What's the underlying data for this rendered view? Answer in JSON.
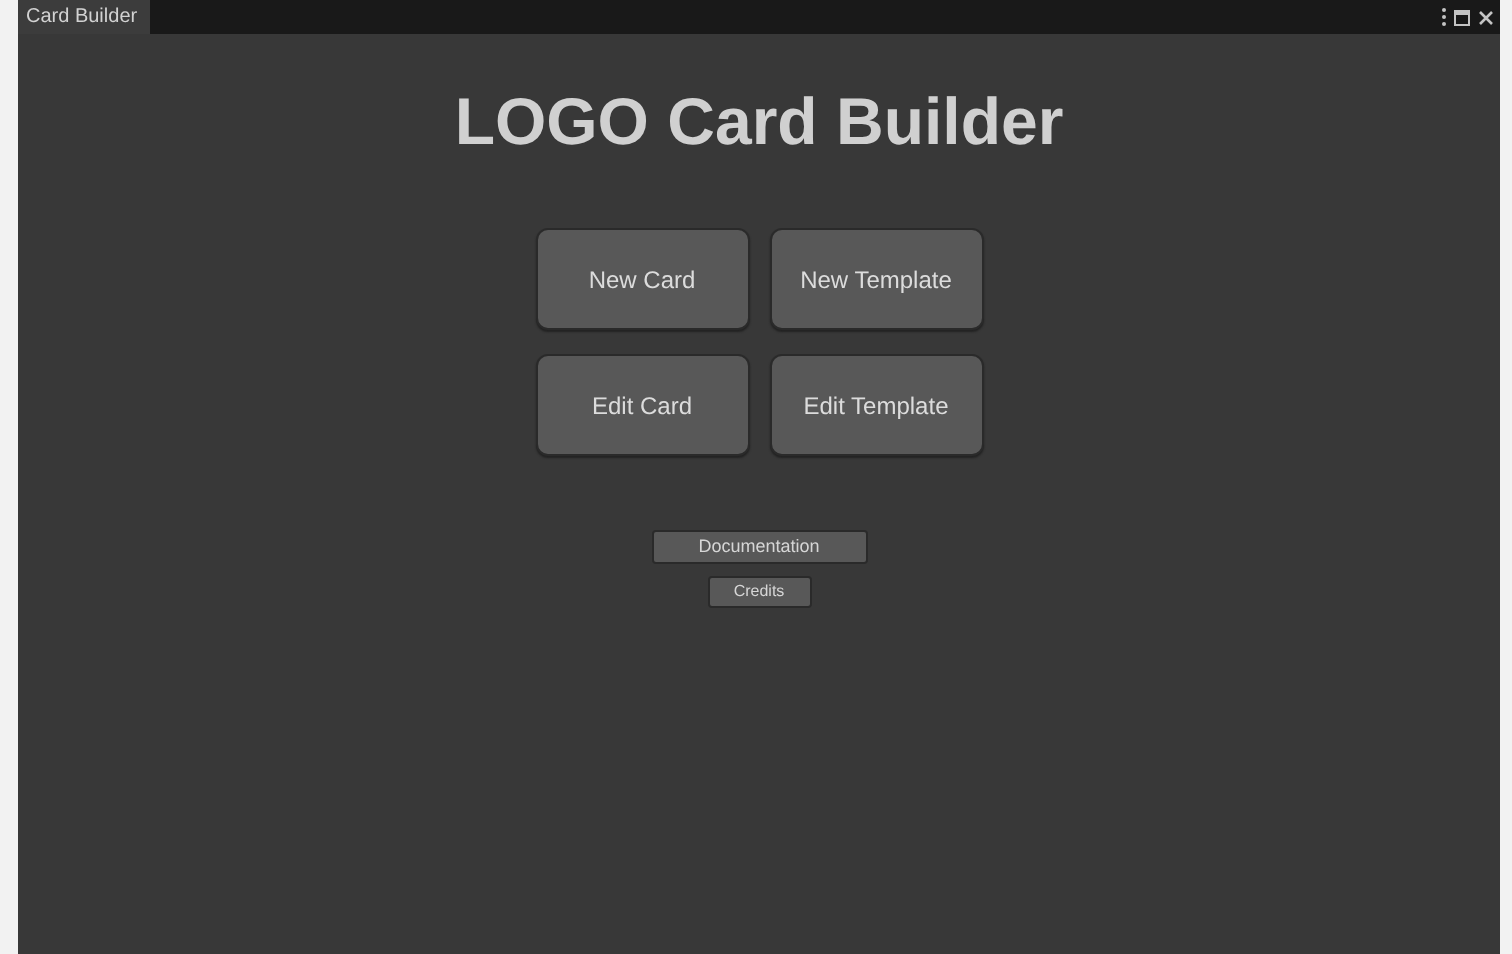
{
  "window": {
    "tab": "Card Builder"
  },
  "title": "LOGO Card Builder",
  "main_buttons": [
    "New Card",
    "New Template",
    "Edit Card",
    "Edit Template"
  ],
  "links": [
    "Documentation",
    "Credits"
  ]
}
